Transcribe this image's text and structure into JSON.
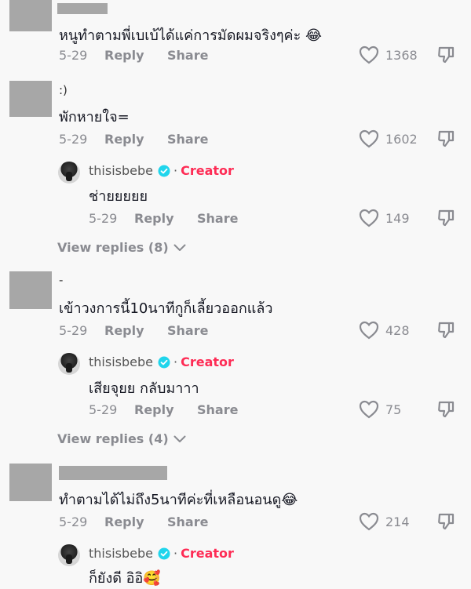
{
  "comments": [
    {
      "handle": "",
      "text": "หนูทำตามพี่เบเบ้ได้แค่การมัดผมจริงๆค่ะ 😂",
      "date": "5-29",
      "reply": "Reply",
      "share": "Share",
      "likes": "1368"
    },
    {
      "handle": ":)",
      "text": "พักหายใจ=",
      "date": "5-29",
      "reply": "Reply",
      "share": "Share",
      "likes": "1602",
      "creator_reply": {
        "name": "thisisbebe",
        "separator": "·",
        "tag": "Creator",
        "text": "ช่ายยยยย",
        "date": "5-29",
        "reply": "Reply",
        "share": "Share",
        "likes": "149"
      },
      "view_replies": "View replies (8)"
    },
    {
      "handle": "-",
      "text": "เข้าวงการนี้10นาทีกูก็เลี้ยวออกแล้ว",
      "date": "5-29",
      "reply": "Reply",
      "share": "Share",
      "likes": "428",
      "creator_reply": {
        "name": "thisisbebe",
        "separator": "·",
        "tag": "Creator",
        "text": "เสียจุยย กลับมาาา",
        "date": "5-29",
        "reply": "Reply",
        "share": "Share",
        "likes": "75"
      },
      "view_replies": "View replies (4)"
    },
    {
      "handle": "",
      "text": "ทำตามได้ไม่ถึง5นาทีค่ะที่เหลือนอนดู😂",
      "date": "5-29",
      "reply": "Reply",
      "share": "Share",
      "likes": "214",
      "creator_reply": {
        "name": "thisisbebe",
        "separator": "·",
        "tag": "Creator",
        "text": "ก็ยังดี อิอิ🥰"
      }
    }
  ],
  "colors": {
    "background": "#f8f8f8",
    "text": "#161823",
    "meta": "#8a8b91",
    "creator": "#fe2c55",
    "verified": "#20d5ec"
  },
  "icons": [
    "heart-outline-icon",
    "dislike-icon",
    "verified-badge-icon",
    "chevron-down-icon"
  ]
}
